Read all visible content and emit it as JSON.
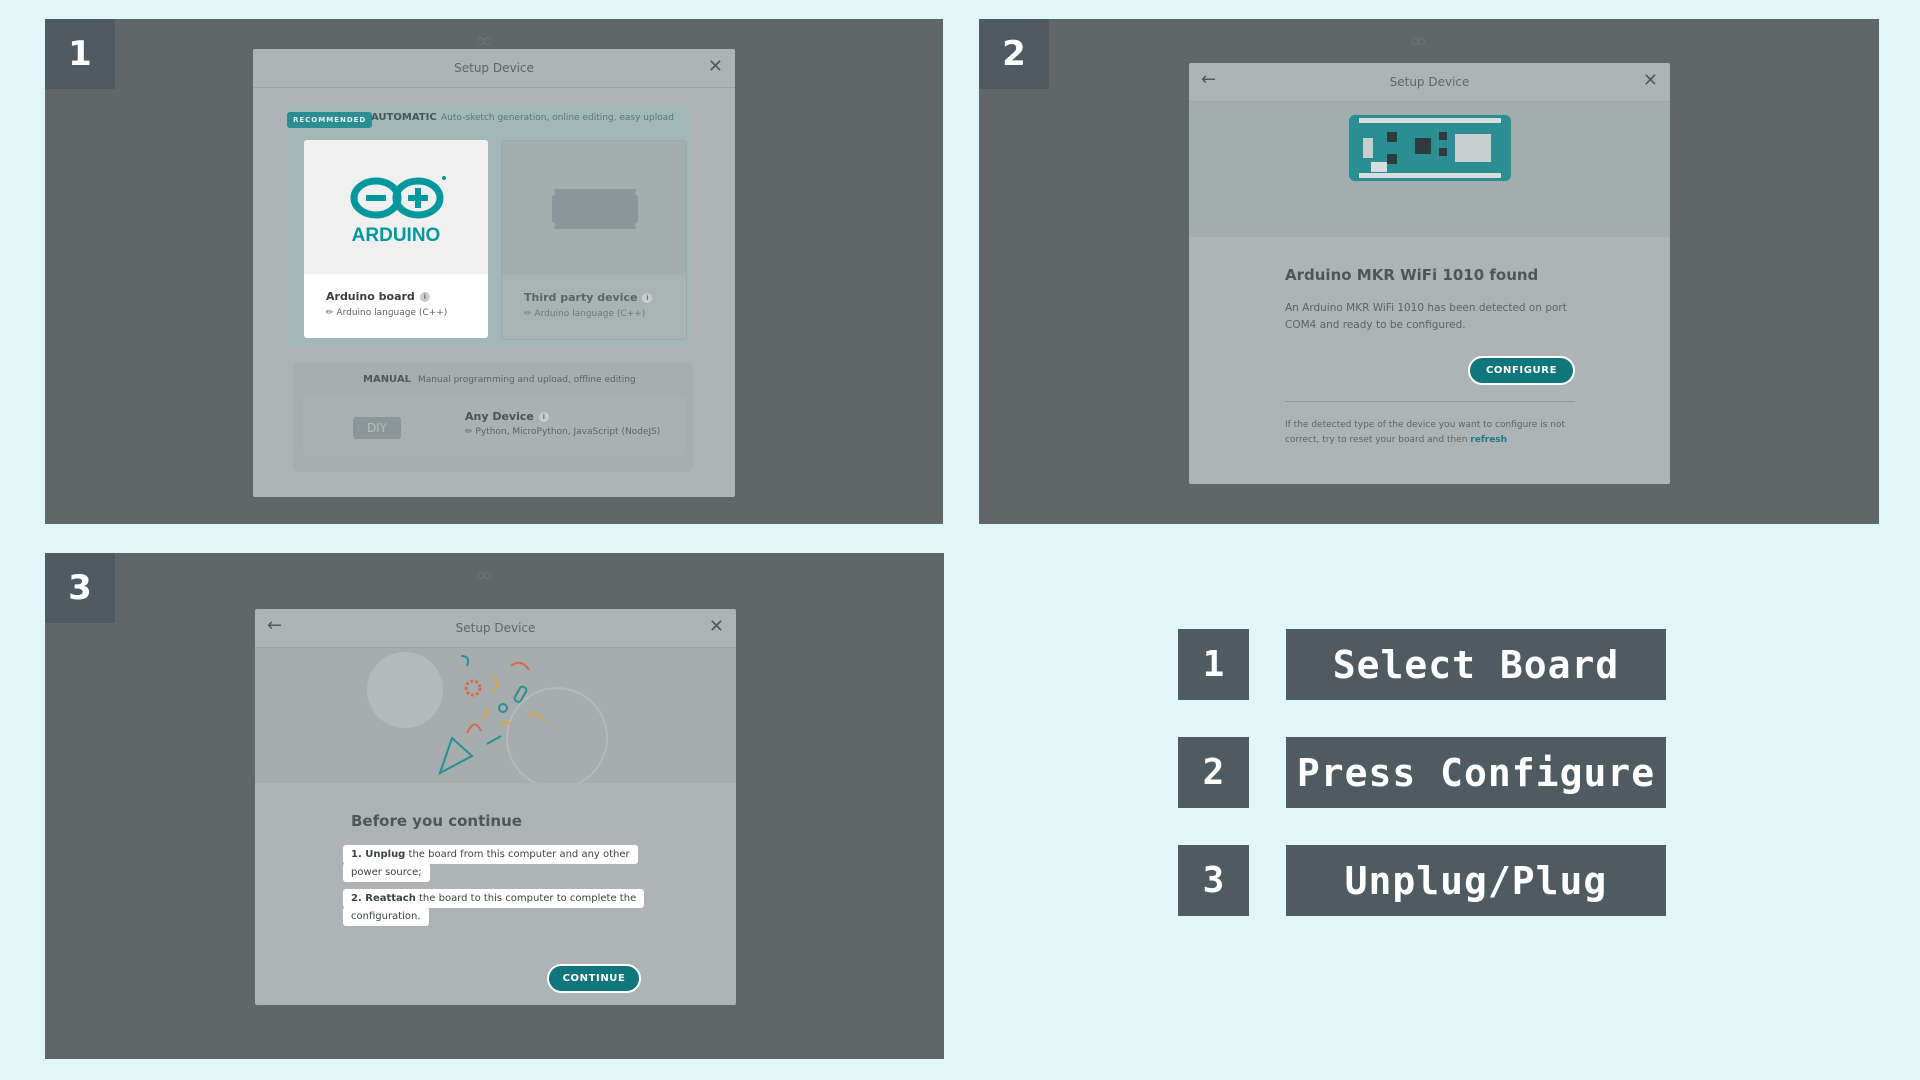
{
  "panels": [
    {
      "step": "1",
      "dialog": {
        "title": "Setup Device",
        "close": "✕",
        "recommended_badge": "RECOMMENDED",
        "automatic_label": "AUTOMATIC",
        "automatic_desc": "Auto-sketch generation, online editing, easy upload",
        "cards": [
          {
            "name": "Arduino board",
            "sub": "Arduino language (C++)",
            "logo_text": "ARDUINO"
          },
          {
            "name": "Third party device",
            "sub": "Arduino language (C++)"
          }
        ],
        "manual_label": "MANUAL",
        "manual_desc": "Manual programming and upload, offline editing",
        "any_device": {
          "name": "Any Device",
          "sub": "Python, MicroPython, JavaScript (NodeJS)",
          "icon_text": "DIY"
        }
      }
    },
    {
      "step": "2",
      "dialog": {
        "title": "Setup Device",
        "back": "←",
        "close": "✕",
        "found_title": "Arduino MKR WiFi 1010 found",
        "found_desc": "An Arduino MKR WiFi 1010 has been detected on port COM4 and ready to be configured.",
        "configure_label": "CONFIGURE",
        "help_text": "If the detected type of the device you want to configure is not correct, try to reset your board and then",
        "help_link": "refresh"
      }
    },
    {
      "step": "3",
      "dialog": {
        "title": "Setup Device",
        "back": "←",
        "close": "✕",
        "before_title": "Before you continue",
        "steps": [
          {
            "bold": "1. Unplug",
            "line1": " the board from this computer and any other",
            "line2": "power source;"
          },
          {
            "bold": "2. Reattach",
            "line1": " the board to this computer to complete the",
            "line2": "configuration."
          }
        ],
        "continue_label": "CONTINUE"
      }
    }
  ],
  "legend": [
    {
      "num": "1",
      "label": "Select Board"
    },
    {
      "num": "2",
      "label": "Press Configure"
    },
    {
      "num": "3",
      "label": "Unplug/Plug"
    }
  ],
  "colors": {
    "background": "#e0f6f7",
    "panel": "#5f6769",
    "badge": "#4f5b61",
    "teal": "#0f777b",
    "arduino_logo": "#00979d"
  }
}
